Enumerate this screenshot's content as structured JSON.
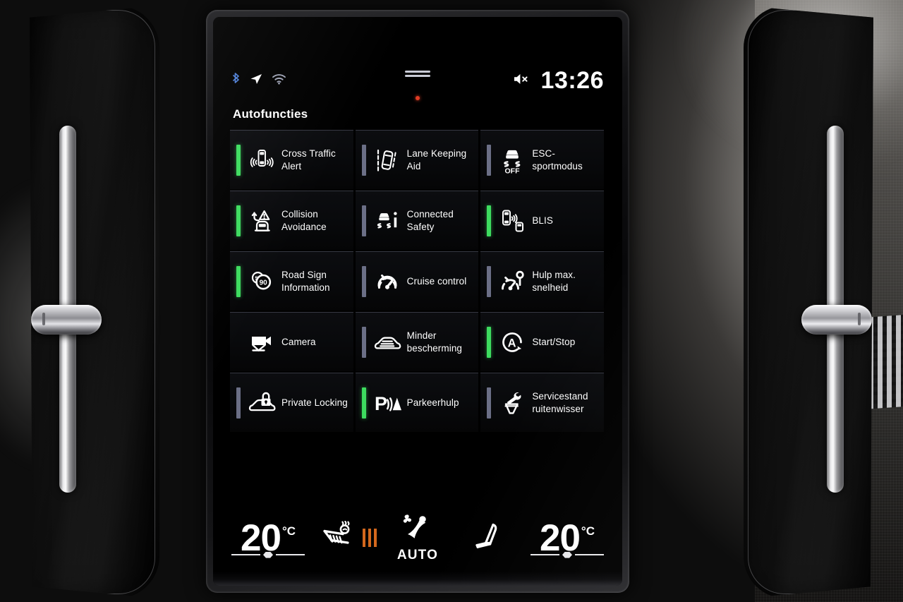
{
  "statusbar": {
    "bluetooth_icon": "bluetooth-icon",
    "navigation_icon": "navigation-arrow-icon",
    "wifi_icon": "wifi-icon",
    "mute_icon": "volume-muted-icon",
    "clock": "13:26",
    "drag_handle_icon": "drag-handle-icon",
    "recording_dot_icon": "recording-dot-icon"
  },
  "page": {
    "title": "Autofuncties"
  },
  "tiles": [
    {
      "label": "Cross Traffic\nAlert",
      "icon": "cross-traffic-alert-icon",
      "status": "on"
    },
    {
      "label": "Lane Keeping\nAid",
      "icon": "lane-keeping-aid-icon",
      "status": "off"
    },
    {
      "label": "ESC-sportmodus",
      "icon": "esc-sport-off-icon",
      "status": "off"
    },
    {
      "label": "Collision\nAvoidance",
      "icon": "collision-avoidance-icon",
      "status": "on"
    },
    {
      "label": "Connected\nSafety",
      "icon": "connected-safety-icon",
      "status": "off"
    },
    {
      "label": "BLIS",
      "icon": "blis-icon",
      "status": "on"
    },
    {
      "label": "Road Sign\nInformation",
      "icon": "road-sign-information-icon",
      "status": "on"
    },
    {
      "label": "Cruise control",
      "icon": "cruise-control-icon",
      "status": "off"
    },
    {
      "label": "Hulp max.\nsnelheid",
      "icon": "speed-limiter-icon",
      "status": "off"
    },
    {
      "label": "Camera",
      "icon": "camera-icon",
      "status": "none"
    },
    {
      "label": "Minder\nbescherming",
      "icon": "reduced-guard-icon",
      "status": "off"
    },
    {
      "label": "Start/Stop",
      "icon": "start-stop-icon",
      "status": "on"
    },
    {
      "label": "Private Locking",
      "icon": "private-locking-icon",
      "status": "off"
    },
    {
      "label": "Parkeerhulp",
      "icon": "park-assist-icon",
      "status": "on"
    },
    {
      "label": "Servicestand\nruitenwisser",
      "icon": "wiper-service-icon",
      "status": "off"
    }
  ],
  "climate": {
    "left_temp": "20",
    "left_unit": "°C",
    "right_temp": "20",
    "right_unit": "°C",
    "seat_heat_icon": "heated-seat-icon",
    "seat_heat_level": 3,
    "fan_icon": "fan-auto-seat-icon",
    "fan_mode": "AUTO",
    "passenger_seat_icon": "seat-icon"
  },
  "colors": {
    "status_on": "#3ddc5f",
    "status_off": "#6b6f86",
    "heat_level": "#d4681d",
    "recording": "#e03c24",
    "text": "#ffffff"
  }
}
